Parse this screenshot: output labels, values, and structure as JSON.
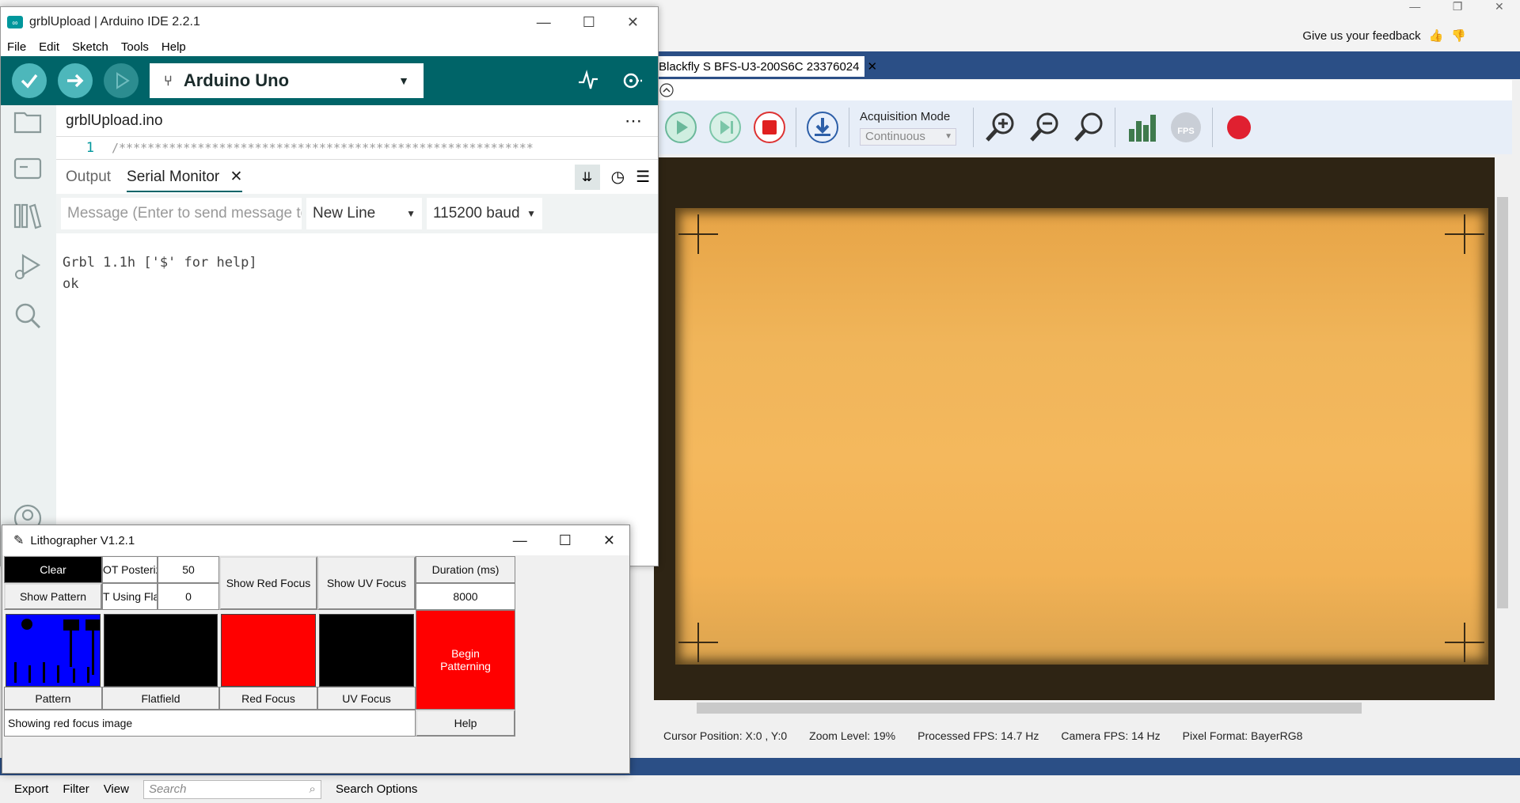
{
  "spinview": {
    "feedback_label": "Give us your feedback",
    "camera_tab": "Blackfly S BFS-U3-200S6C 23376024",
    "acquisition_mode_label": "Acquisition Mode",
    "acquisition_mode_value": "Continuous",
    "status": {
      "cursor": "Cursor Position: X:0 , Y:0",
      "zoom": "Zoom Level: 19%",
      "processed_fps": "Processed FPS: 14.7 Hz",
      "camera_fps": "Camera FPS: 14 Hz",
      "pixel_format": "Pixel Format: BayerRG8"
    },
    "bottom": {
      "export": "Export",
      "filter": "Filter",
      "view": "View",
      "search_placeholder": "Search",
      "search_options": "Search Options"
    }
  },
  "arduino": {
    "title": "grblUpload | Arduino IDE 2.2.1",
    "menu": [
      "File",
      "Edit",
      "Sketch",
      "Tools",
      "Help"
    ],
    "board": "Arduino Uno",
    "file_tab": "grblUpload.ino",
    "line_number": "1",
    "code_line": "/**********************************************************",
    "tab_output": "Output",
    "tab_serial": "Serial Monitor",
    "message_placeholder": "Message (Enter to send message to 'Ar...",
    "line_ending": "New Line",
    "baud": "115200 baud",
    "output_lines": [
      "Grbl 1.1h ['$' for help]",
      "ok"
    ]
  },
  "lithographer": {
    "title": "Lithographer V1.2.1",
    "clear": "Clear",
    "show_pattern": "Show Pattern",
    "posterize_label": "OT Posterizi",
    "posterize_value": "50",
    "flatfield_label": "T Using Flatf",
    "flatfield_value": "0",
    "show_red_focus": "Show Red Focus",
    "show_uv_focus": "Show UV Focus",
    "duration_label": "Duration (ms)",
    "duration_value": "8000",
    "begin_patterning": "Begin Patterning",
    "thumb_pattern": "Pattern",
    "thumb_flatfield": "Flatfield",
    "thumb_red": "Red Focus",
    "thumb_uv": "UV Focus",
    "status": "Showing red focus image",
    "help": "Help"
  },
  "colors": {
    "arduino_teal": "#006468",
    "spin_blue": "#2b4f86",
    "red": "#ff0000",
    "pattern_blue": "#0000ff"
  }
}
